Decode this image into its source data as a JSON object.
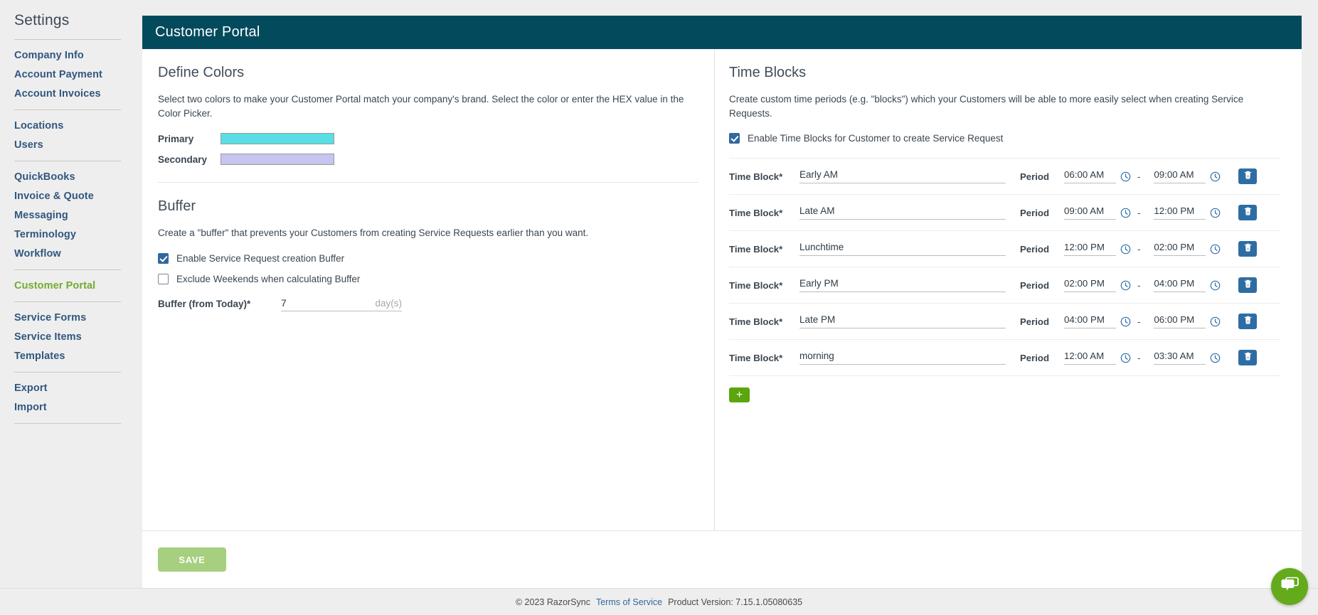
{
  "sidebar": {
    "title": "Settings",
    "groups": [
      {
        "items": [
          {
            "label": "Company Info",
            "active": false
          },
          {
            "label": "Account Payment",
            "active": false
          },
          {
            "label": "Account Invoices",
            "active": false
          }
        ]
      },
      {
        "items": [
          {
            "label": "Locations",
            "active": false
          },
          {
            "label": "Users",
            "active": false
          }
        ]
      },
      {
        "items": [
          {
            "label": "QuickBooks",
            "active": false
          },
          {
            "label": "Invoice & Quote",
            "active": false
          },
          {
            "label": "Messaging",
            "active": false
          },
          {
            "label": "Terminology",
            "active": false
          },
          {
            "label": "Workflow",
            "active": false
          }
        ]
      },
      {
        "items": [
          {
            "label": "Customer Portal",
            "active": true
          }
        ]
      },
      {
        "items": [
          {
            "label": "Service Forms",
            "active": false
          },
          {
            "label": "Service Items",
            "active": false
          },
          {
            "label": "Templates",
            "active": false
          }
        ]
      },
      {
        "items": [
          {
            "label": "Export",
            "active": false
          },
          {
            "label": "Import",
            "active": false
          }
        ]
      }
    ]
  },
  "header": {
    "title": "Customer Portal"
  },
  "define_colors": {
    "heading": "Define Colors",
    "description": "Select two colors to make your Customer Portal match your company's brand. Select the color or enter the HEX value in the Color Picker.",
    "primary_label": "Primary",
    "primary_color": "#5ADEE5",
    "secondary_label": "Secondary",
    "secondary_color": "#C6C4F0"
  },
  "buffer": {
    "heading": "Buffer",
    "description": "Create a \"buffer\" that prevents your Customers from creating Service Requests earlier than you want.",
    "enable_label": "Enable Service Request creation Buffer",
    "enable_checked": true,
    "exclude_weekends_label": "Exclude Weekends when calculating Buffer",
    "exclude_weekends_checked": false,
    "field_label": "Buffer (from Today)*",
    "field_value": "7",
    "field_unit": "day(s)"
  },
  "time_blocks": {
    "heading": "Time Blocks",
    "description": "Create custom time periods (e.g. \"blocks\") which your Customers will be able to more easily select when creating Service Requests.",
    "enable_label": "Enable Time Blocks for Customer to create Service Request",
    "enable_checked": true,
    "row_label": "Time Block*",
    "period_label": "Period",
    "dash": "-",
    "add_label": "+",
    "rows": [
      {
        "name": "Early AM",
        "start": "06:00 AM",
        "end": "09:00 AM"
      },
      {
        "name": "Late AM",
        "start": "09:00 AM",
        "end": "12:00 PM"
      },
      {
        "name": "Lunchtime",
        "start": "12:00 PM",
        "end": "02:00 PM"
      },
      {
        "name": "Early PM",
        "start": "02:00 PM",
        "end": "04:00 PM"
      },
      {
        "name": "Late PM",
        "start": "04:00 PM",
        "end": "06:00 PM"
      },
      {
        "name": "morning",
        "start": "12:00 AM",
        "end": "03:30 AM"
      }
    ]
  },
  "actions": {
    "save_label": "SAVE"
  },
  "footer": {
    "copyright": "© 2023 RazorSync",
    "terms_label": "Terms of Service",
    "version": "Product Version: 7.15.1.05080635"
  },
  "colors": {
    "titlebar": "#034A5C",
    "sidebar_link": "#31577F",
    "sidebar_active": "#72AC2E",
    "checkbox": "#31699C",
    "delete_button": "#2E6DA4",
    "add_button": "#5BA50F",
    "save_button": "#A6CF7F",
    "chat_button": "#64AB1C"
  }
}
